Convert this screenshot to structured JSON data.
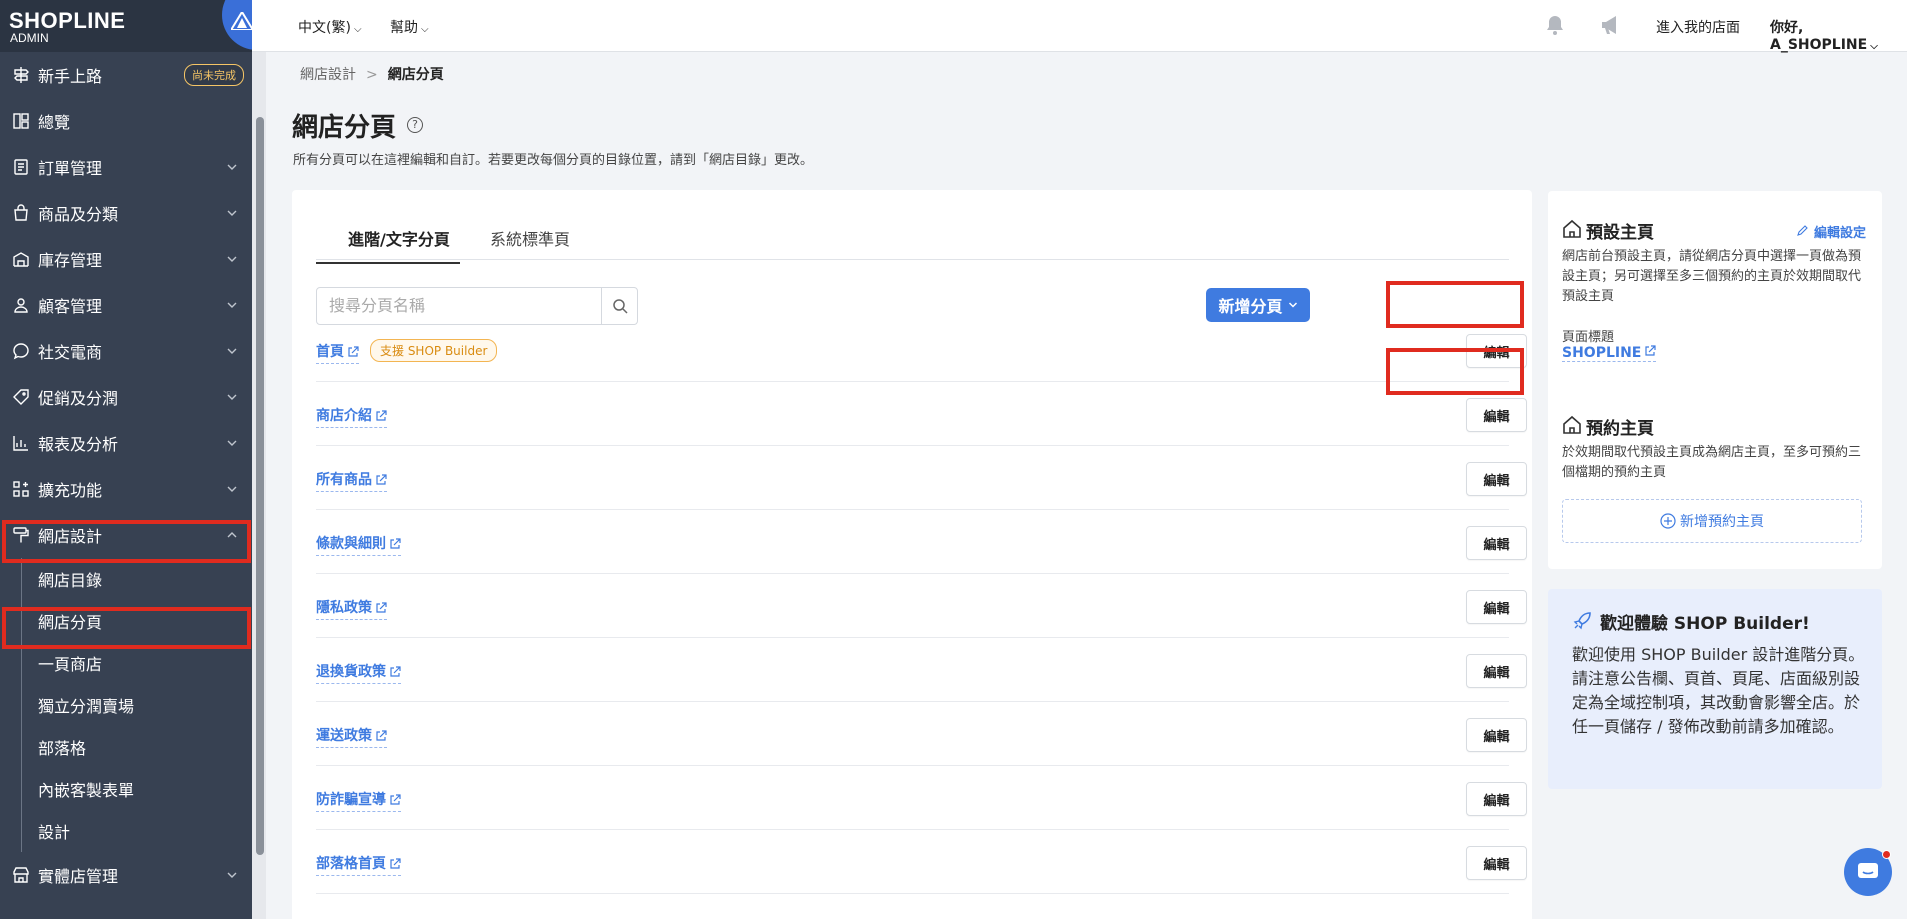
{
  "brand": {
    "logo": "SHOPLINE",
    "sub": "ADMIN"
  },
  "sidebar": {
    "items": [
      {
        "label": "新手上路",
        "icon": "signpost-icon",
        "badge": "尚未完成"
      },
      {
        "label": "總覽",
        "icon": "dashboard-icon"
      },
      {
        "label": "訂單管理",
        "icon": "order-icon"
      },
      {
        "label": "商品及分類",
        "icon": "bag-icon"
      },
      {
        "label": "庫存管理",
        "icon": "warehouse-icon"
      },
      {
        "label": "顧客管理",
        "icon": "user-icon"
      },
      {
        "label": "社交電商",
        "icon": "chat-bubble-icon"
      },
      {
        "label": "促銷及分潤",
        "icon": "tag-icon"
      },
      {
        "label": "報表及分析",
        "icon": "chart-icon"
      },
      {
        "label": "擴充功能",
        "icon": "apps-icon"
      },
      {
        "label": "網店設計",
        "icon": "paint-roller-icon"
      }
    ],
    "sub_items": [
      "網店目錄",
      "網店分頁",
      "一頁商店",
      "獨立分潤賣場",
      "部落格",
      "內嵌客製表單",
      "設計"
    ],
    "bottom_item": {
      "label": "實體店管理",
      "icon": "store-icon"
    }
  },
  "topbar": {
    "language": "中文(繁)",
    "help": "幫助",
    "enter_store": "進入我的店面",
    "greeting": "你好, A_SHOPLINE"
  },
  "breadcrumb": {
    "parent": "網店設計",
    "current": "網店分頁"
  },
  "page": {
    "title": "網店分頁",
    "description": "所有分頁可以在這裡編輯和自訂。若要更改每個分頁的目錄位置，請到「網店目錄」更改。"
  },
  "tabs": [
    "進階/文字分頁",
    "系統標準頁"
  ],
  "search": {
    "placeholder": "搜尋分頁名稱"
  },
  "add_button": "新增分頁",
  "edit_label": "編輯",
  "builder_badge": "支援 SHOP Builder",
  "pages": [
    "首頁",
    "商店介紹",
    "所有商品",
    "條款與細則",
    "隱私政策",
    "退換貨政策",
    "運送政策",
    "防詐騙宣導",
    "部落格首頁"
  ],
  "default_home": {
    "title": "預設主頁",
    "edit": "編輯設定",
    "desc": "網店前台預設主頁，請從網店分頁中選擇一頁做為預設主頁；另可選擇至多三個預約的主頁於效期間取代預設主頁",
    "label": "頁面標題",
    "value": "SHOPLINE"
  },
  "scheduled_home": {
    "title": "預約主頁",
    "desc": "於效期間取代預設主頁成為網店主頁，至多可預約三個檔期的預約主頁",
    "add": "新增預約主頁"
  },
  "welcome": {
    "title": "歡迎體驗 SHOP Builder!",
    "text": "歡迎使用 SHOP Builder 設計進階分頁。請注意公告欄、頁首、頁尾、店面級別設定為全域控制項，其改動會影響全店。於任一頁儲存 / 發佈改動前請多加確認。"
  },
  "colors": {
    "sidebar": "#374152",
    "accent": "#3f7be0",
    "highlight": "#e02b1f",
    "badge": "#f5c566"
  }
}
